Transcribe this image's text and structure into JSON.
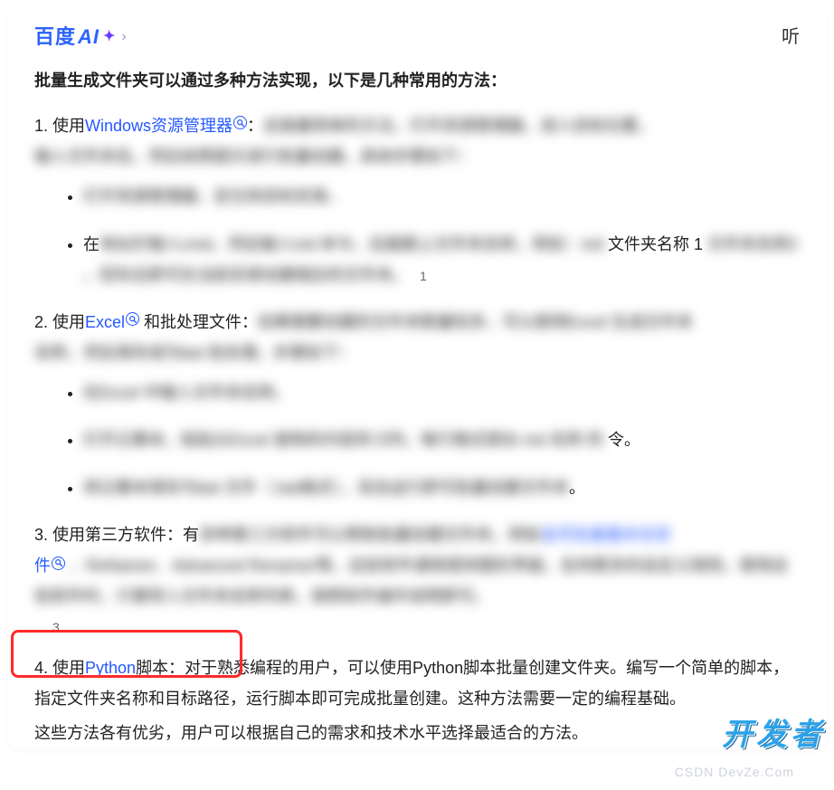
{
  "brand": {
    "label": "百度",
    "ai": "AI",
    "sparkle": "✦",
    "chev": "›"
  },
  "listen": "听",
  "intro": "批量生成文件夹可以通过多种方法实现，以下是几种常用的方法：",
  "m1": {
    "idx": "1. ",
    "strong": "使用",
    "link": "Windows资源管理器",
    "after": "：",
    "blur_a": "这是最简单的方法，打开资源管理器，进入目标位置，",
    "blur_b": "输入文件夹名。然后依照提示进行批量创建。具体步骤如下：",
    "li1_blur": "打开资源管理器，定位到目标目录。",
    "li2_pre": "在",
    "li2_blur": "地址栏输入cmd，然后输入md 命令。后面跟上文件夹名称，例如：md ",
    "li2_tail": "文件夹名称",
    "li3_a": "1 ",
    "li3_blur": "文件夹名称2 。回车后即可在当前目录创建相应的文件夹。",
    "ref": "1"
  },
  "m2": {
    "idx": "2. ",
    "strong": "使用",
    "link": "Excel",
    "after": "和批处理文件：",
    "blur_a": "如果需要创建的文件夹数量较多，可以使用Excel 生成文件夹",
    "blur_b": "名称，然后保存成为bat 批处理。步骤如下：",
    "li1_blur": "在Excel 中输入文件夹名称。",
    "li2_blur_a": "打开记事本，粘贴从Excel 复制的内容到 D列",
    "li2_blur_b": "，每行格式类似 md 名称 的",
    "li2_tail": "令。",
    "li3_blur": "将记事本保存为bat 文件（.bat格式），双击运行即可批量创建文件夹",
    "li3_tail": "。"
  },
  "m3": {
    "idx": "3. ",
    "strong": "使用第三方软件：",
    "after_a": "有",
    "blur_a": "多种第三方软件可以帮助批量创建文件夹，例如",
    "link_blur": "金芳批量重命名软",
    "link2": "件",
    "blur_b": "、ReNamer、Advanced Renamer等。这些软件通常提供图形界面，支持更多的自定义规则。使用这些软件时，只需导入文件夹名称列表，按照软件操作说明即可。",
    "ref": "3"
  },
  "m4": {
    "idx": "4. ",
    "strong": "使用",
    "link": "Python",
    "strong2": "脚本：",
    "body": "对于熟悉编程的用户，可以使用Python脚本批量创建文件夹。编写一个简单的脚本，指定文件夹名称和目标路径，运行脚本即可完成批量创建。这种方法需要一定的编程基础。"
  },
  "closing": "这些方法各有优劣，用户可以根据自己的需求和技术水平选择最适合的方法。",
  "watermark_logo": "开发者",
  "watermark_site": "CSDN   DevZe.Com"
}
